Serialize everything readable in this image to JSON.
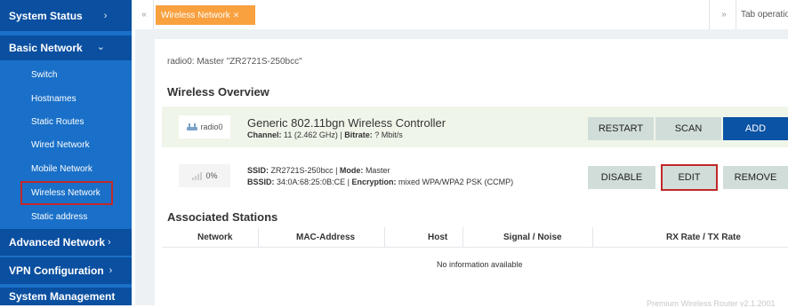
{
  "sidebar": {
    "system_status": "System Status",
    "system_status_arrow": "›",
    "basic_network": "Basic Network",
    "basic_network_arrow": "⌄",
    "items": [
      {
        "label": "Switch"
      },
      {
        "label": "Hostnames"
      },
      {
        "label": "Static Routes"
      },
      {
        "label": "Wired Network"
      },
      {
        "label": "Mobile Network"
      },
      {
        "label": "Wireless Network"
      },
      {
        "label": "Static address"
      }
    ],
    "advanced_network": "Advanced Network",
    "advanced_network_arrow": "›",
    "vpn_configuration": "VPN Configuration",
    "vpn_configuration_arrow": "›",
    "system_management": "System Management"
  },
  "tabbar": {
    "prev_glyph": "«",
    "active_tab": "Wireless Network",
    "close_glyph": "✕",
    "next_glyph": "»",
    "tab_operations": "Tab operatio"
  },
  "content": {
    "breadcrumb": "radio0: Master \"ZR2721S-250bcc\"",
    "overview_heading": "Wireless Overview",
    "device": {
      "icon_label": "radio0",
      "title": "Generic 802.11bgn Wireless Controller",
      "channel_label": "Channel:",
      "channel_value": "11 (2.462 GHz)",
      "bitrate_label": "Bitrate:",
      "bitrate_value": "? Mbit/s",
      "buttons": {
        "restart": "RESTART",
        "scan": "SCAN",
        "add": "ADD"
      }
    },
    "network": {
      "signal_label": "0%",
      "ssid_label": "SSID:",
      "ssid_value": "ZR2721S-250bcc",
      "mode_label": "Mode:",
      "mode_value": "Master",
      "bssid_label": "BSSID:",
      "bssid_value": "34:0A:68:25:0B:CE",
      "encryption_label": "Encryption:",
      "encryption_value": "mixed WPA/WPA2 PSK (CCMP)",
      "buttons": {
        "disable": "DISABLE",
        "edit": "EDIT",
        "remove": "REMOVE"
      }
    },
    "stations_heading": "Associated Stations",
    "columns": [
      "Network",
      "MAC-Address",
      "Host",
      "Signal / Noise",
      "RX Rate / TX Rate"
    ],
    "empty_message": "No information available",
    "footer": "Premium Wireless Router v2.1.2001"
  },
  "colors": {
    "sidebar_bg": "#1a70c8",
    "sidebar_section_bg": "#0a4fa0",
    "active_tab": "#f9a03f",
    "primary_button": "#0b53a5",
    "secondary_button": "#d1ddd9",
    "highlight_border": "#c0282a"
  }
}
